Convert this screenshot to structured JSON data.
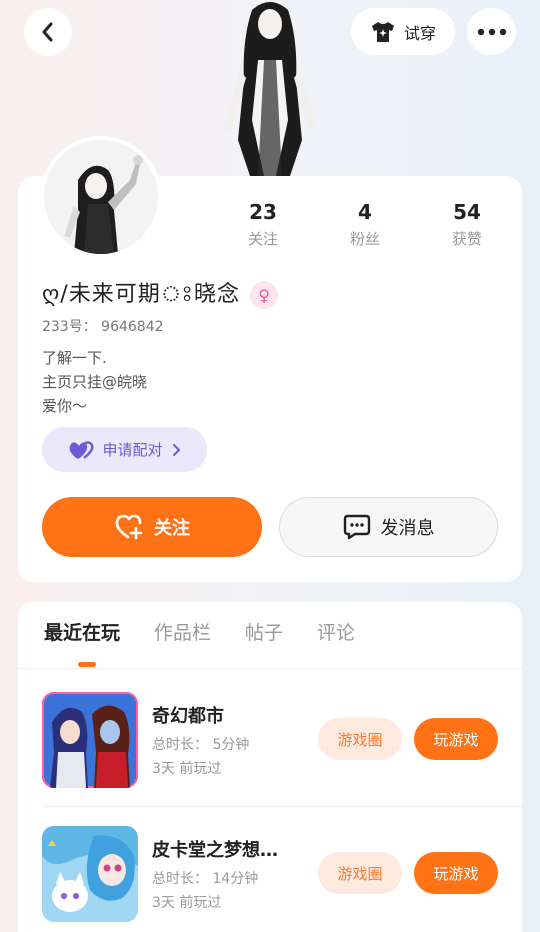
{
  "header": {
    "tryon_label": "试穿"
  },
  "profile": {
    "nickname": "ღ/未来可期ঃ晓念",
    "gender_symbol": "♀",
    "uid": "233号： 9646842",
    "bio": "了解一下.\n主页只挂@皖晓\n爱你～",
    "pair_label": "申请配对",
    "follow_label": "关注",
    "message_label": "发消息",
    "stats": [
      {
        "value": "23",
        "label": "关注"
      },
      {
        "value": "4",
        "label": "粉丝"
      },
      {
        "value": "54",
        "label": "获赞"
      }
    ]
  },
  "tabs": [
    {
      "label": "最近在玩",
      "active": true
    },
    {
      "label": "作品栏",
      "active": false
    },
    {
      "label": "帖子",
      "active": false
    },
    {
      "label": "评论",
      "active": false
    }
  ],
  "games": [
    {
      "name": "奇幻都市",
      "duration": "总时长： 5分钟",
      "last_played": "3天 前玩过",
      "circle_label": "游戏圈",
      "play_label": "玩游戏"
    },
    {
      "name": "皮卡堂之梦想…",
      "duration": "总时长： 14分钟",
      "last_played": "3天 前玩过",
      "circle_label": "游戏圈",
      "play_label": "玩游戏"
    }
  ],
  "colors": {
    "accent": "#ff7216",
    "pair": "#6b5cd6",
    "gender": "#ee5a95"
  }
}
